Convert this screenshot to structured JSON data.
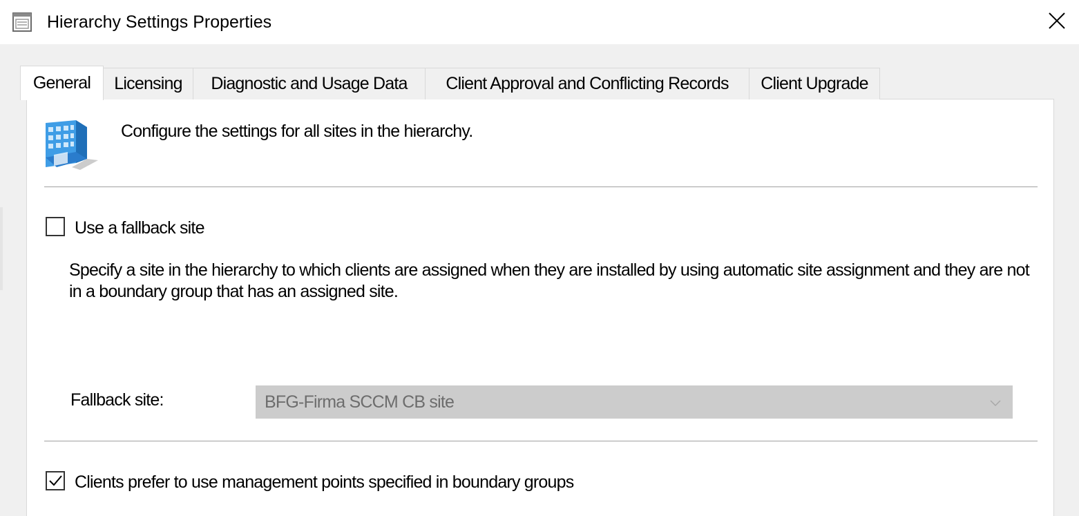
{
  "window": {
    "title": "Hierarchy Settings Properties",
    "icon": "properties-window-icon",
    "close_icon": "close-icon"
  },
  "tabs": [
    {
      "label": "General",
      "active": true
    },
    {
      "label": "Licensing",
      "active": false
    },
    {
      "label": "Diagnostic and Usage Data",
      "active": false
    },
    {
      "label": "Client Approval and Conflicting Records",
      "active": false
    },
    {
      "label": "Client Upgrade",
      "active": false
    }
  ],
  "general": {
    "header_icon": "hierarchy-building-icon",
    "header_text": "Configure the settings for all sites in the hierarchy.",
    "fallback": {
      "checkbox_label": "Use a fallback site",
      "checked": false,
      "description": "Specify a site in the hierarchy to which clients are assigned when they are installed by using automatic site assignment and they are not in a boundary group that has an assigned site.",
      "field_label": "Fallback site:",
      "selected_value": "BFG-Firma SCCM CB site",
      "enabled": false
    },
    "prefer_mp": {
      "checkbox_label": "Clients prefer to use management points specified in boundary groups",
      "checked": true
    }
  }
}
